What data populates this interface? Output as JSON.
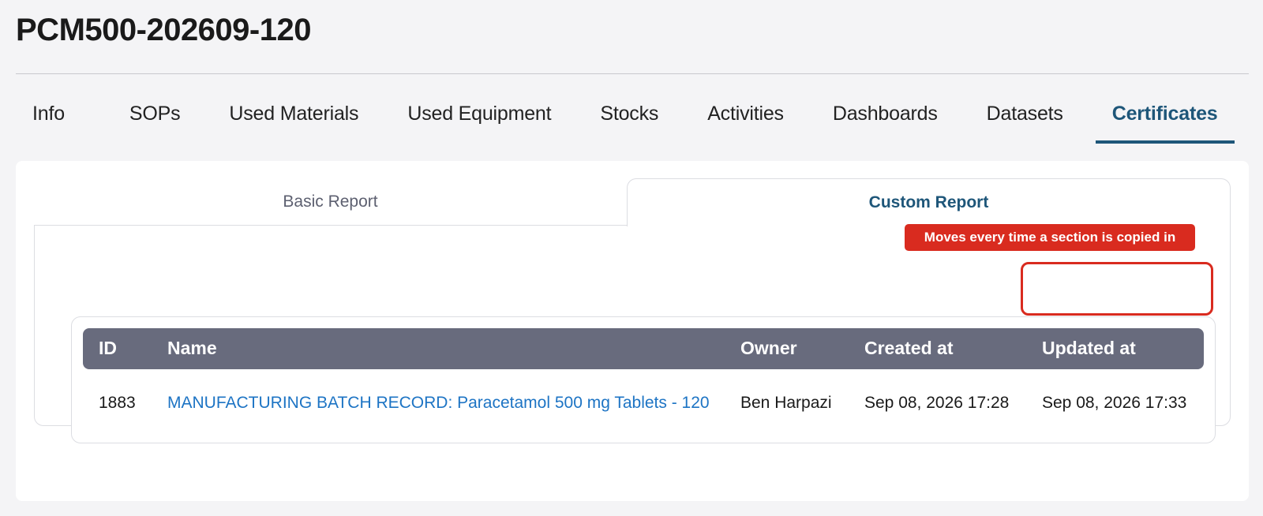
{
  "page": {
    "title": "PCM500-202609-120"
  },
  "tabs": [
    {
      "label": "Info"
    },
    {
      "label": "SOPs"
    },
    {
      "label": "Used Materials"
    },
    {
      "label": "Used Equipment"
    },
    {
      "label": "Stocks"
    },
    {
      "label": "Activities"
    },
    {
      "label": "Dashboards"
    },
    {
      "label": "Datasets"
    },
    {
      "label": "Certificates",
      "active": true
    }
  ],
  "report_tabs": {
    "basic": "Basic Report",
    "custom": "Custom Report"
  },
  "annotation": {
    "text": "Moves every time a section is copied in"
  },
  "table": {
    "headers": {
      "id": "ID",
      "name": "Name",
      "owner": "Owner",
      "created": "Created at",
      "updated": "Updated at"
    },
    "rows": [
      {
        "id": "1883",
        "name": "MANUFACTURING BATCH RECORD: Paracetamol 500 mg Tablets - 120",
        "owner": "Ben Harpazi",
        "created": "Sep 08, 2026 17:28",
        "updated": "Sep 08, 2026 17:33"
      }
    ]
  },
  "colors": {
    "accent": "#1e5679",
    "link": "#1d74c4",
    "table_header": "#686b7d",
    "annotation": "#d92b1f"
  }
}
